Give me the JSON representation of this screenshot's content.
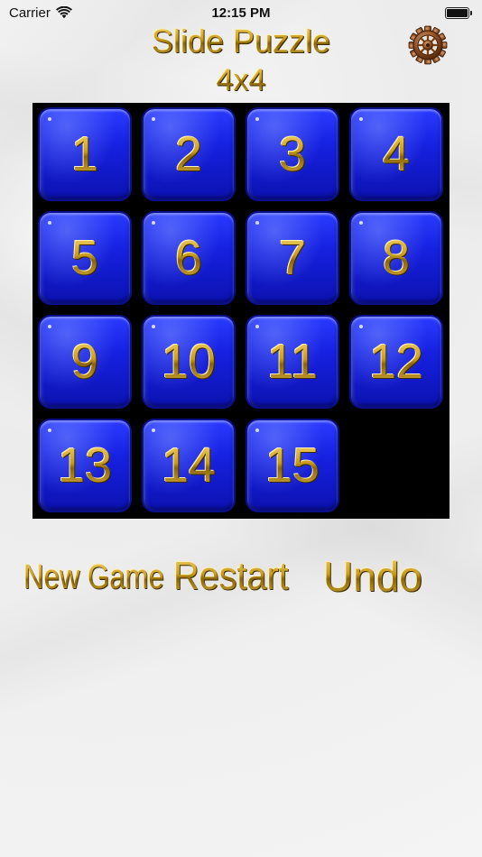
{
  "status_bar": {
    "carrier": "Carrier",
    "time": "12:15 PM",
    "wifi_icon": "wifi-icon",
    "battery_icon": "battery-icon"
  },
  "header": {
    "title": "Slide Puzzle",
    "subtitle": "4x4",
    "settings_icon": "gear-icon"
  },
  "board": {
    "rows": 4,
    "cols": 4,
    "tiles": [
      [
        "1",
        "2",
        "3",
        "4"
      ],
      [
        "5",
        "6",
        "7",
        "8"
      ],
      [
        "9",
        "10",
        "11",
        "12"
      ],
      [
        "13",
        "14",
        "15",
        ""
      ]
    ]
  },
  "actions": {
    "new_game": "New Game",
    "restart": "Restart",
    "undo": "Undo"
  },
  "colors": {
    "tile_blue": "#1621e0",
    "board_background": "#000000",
    "gold": "#c99b1b"
  }
}
